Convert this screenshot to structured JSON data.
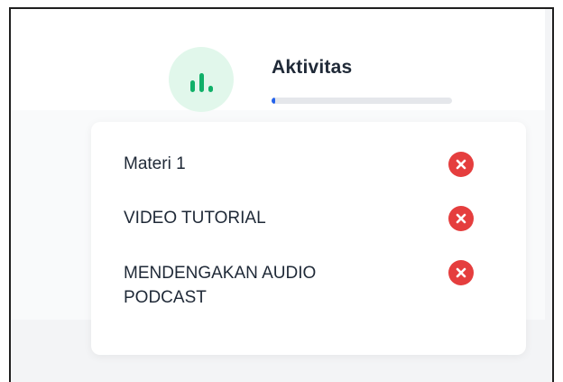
{
  "header": {
    "title": "Aktivitas",
    "progress_fraction": 0.02,
    "icon": "bar-chart-icon"
  },
  "activities": [
    {
      "label": "Materi 1",
      "status_icon": "x-circle-icon",
      "status": "incomplete"
    },
    {
      "label": "VIDEO TUTORIAL",
      "status_icon": "x-circle-icon",
      "status": "incomplete"
    },
    {
      "label": "MENDENGAKAN AUDIO PODCAST",
      "status_icon": "x-circle-icon",
      "status": "incomplete"
    }
  ],
  "colors": {
    "accent_green": "#10b068",
    "icon_bg": "#e1f7eb",
    "progress": "#2563eb",
    "status_red": "#e53e3e"
  }
}
